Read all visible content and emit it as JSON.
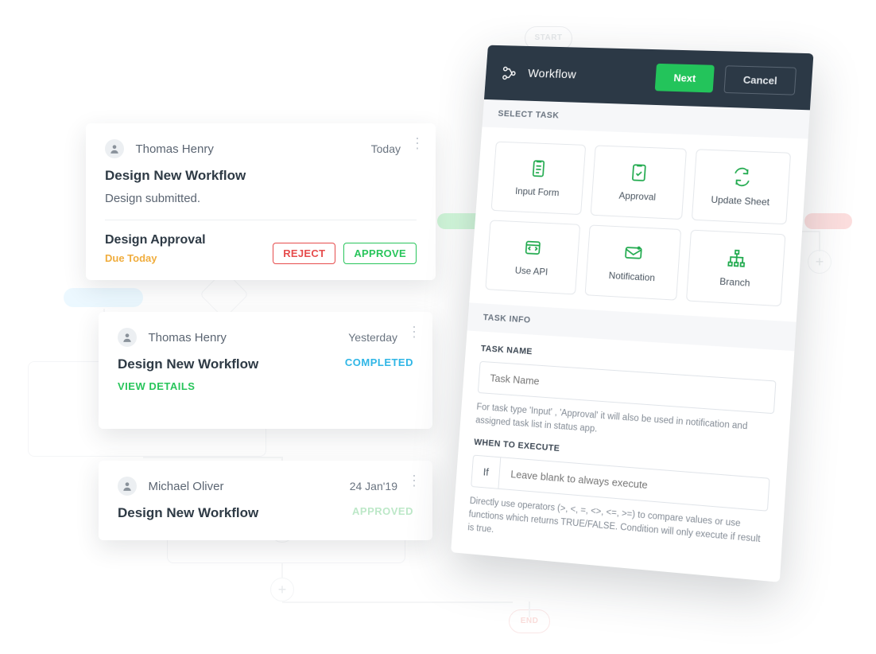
{
  "bg": {
    "start": "START",
    "end": "END"
  },
  "cards": [
    {
      "name": "Thomas Henry",
      "date": "Today",
      "title": "Design New Workflow",
      "subtitle": "Design submitted.",
      "section": "Design Approval",
      "due": "Due Today",
      "reject": "REJECT",
      "approve": "APPROVE"
    },
    {
      "name": "Thomas Henry",
      "date": "Yesterday",
      "title": "Design New Workflow",
      "status": "COMPLETED",
      "link": "VIEW DETAILS"
    },
    {
      "name": "Michael Oliver",
      "date": "24 Jan'19",
      "title": "Design New Workflow",
      "status": "APPROVED"
    }
  ],
  "panel": {
    "title": "Workflow",
    "next": "Next",
    "cancel": "Cancel",
    "section_select": "SELECT TASK",
    "tasks": [
      "Input Form",
      "Approval",
      "Update Sheet",
      "Use API",
      "Notification",
      "Branch"
    ],
    "section_info": "TASK INFO",
    "task_name_label": "TASK NAME",
    "task_name_placeholder": "Task Name",
    "task_name_hint": "For task type 'Input' , 'Approval' it will also be used in notification and assigned task list in status app.",
    "when_label": "WHEN TO EXECUTE",
    "if_label": "If",
    "if_placeholder": "Leave blank to always execute",
    "when_hint": "Directly use operators (>, <, =, <>, <=, >=) to compare values or use functions which returns TRUE/FALSE. Condition will only execute if result is true."
  }
}
